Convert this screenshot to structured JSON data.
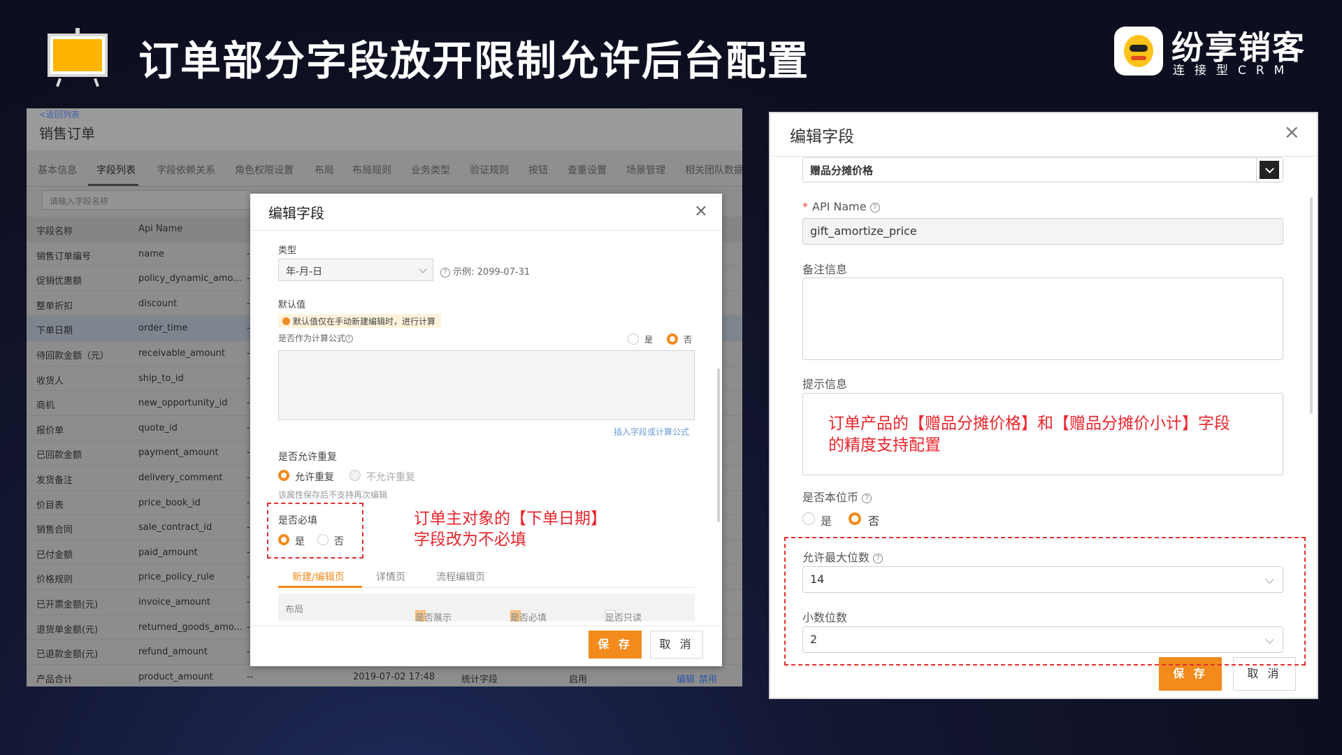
{
  "slide": {
    "title": "订单部分字段放开限制允许后台配置",
    "brand_name": "纷享销客",
    "brand_sub": "连接型CRM",
    "accent": "#f28a1c",
    "note_color": "#e8262d"
  },
  "left_screen": {
    "back_link": "<返回列表",
    "page_title": "销售订单",
    "tabs": [
      "基本信息",
      "字段列表",
      "字段依赖关系",
      "角色权限设置",
      "布局",
      "布局规则",
      "业务类型",
      "验证规则",
      "按钮",
      "查重设置",
      "场景管理",
      "相关团队数据"
    ],
    "active_tab": "字段列表",
    "search_placeholder": "请输入字段名称",
    "table_headers": [
      "字段名称",
      "Api Name"
    ],
    "rows": [
      {
        "name": "销售订单编号",
        "api": "name"
      },
      {
        "name": "促销优惠额",
        "api": "policy_dynamic_amo..."
      },
      {
        "name": "整单折扣",
        "api": "discount"
      },
      {
        "name": "下单日期",
        "api": "order_time"
      },
      {
        "name": "待回款金额（元）",
        "api": "receivable_amount"
      },
      {
        "name": "收货人",
        "api": "ship_to_id"
      },
      {
        "name": "商机",
        "api": "new_opportunity_id"
      },
      {
        "name": "报价单",
        "api": "quote_id"
      },
      {
        "name": "已回款金额",
        "api": "payment_amount"
      },
      {
        "name": "发货备注",
        "api": "delivery_comment"
      },
      {
        "name": "价目表",
        "api": "price_book_id"
      },
      {
        "name": "销售合同",
        "api": "sale_contract_id"
      },
      {
        "name": "已付金额",
        "api": "paid_amount"
      },
      {
        "name": "价格规则",
        "api": "price_policy_rule"
      },
      {
        "name": "已开票金额(元)",
        "api": "invoice_amount"
      },
      {
        "name": "退货单金额(元)",
        "api": "returned_goods_amo..."
      },
      {
        "name": "已退款金额(元)",
        "api": "refund_amount"
      }
    ],
    "last_row": {
      "name": "产品合计",
      "api": "product_amount",
      "dash": "--",
      "time": "2019-07-02 17:48",
      "kind": "统计字段",
      "status": "启用",
      "edit": "编辑",
      "disable": "禁用"
    },
    "row_dash": "--"
  },
  "left_modal": {
    "title": "编辑字段",
    "close": "×",
    "type_label": "类型",
    "type_value": "年-月-日",
    "example": "示例: 2099-07-31",
    "default_label": "默认值",
    "default_warning": "默认值仅在手动新建编辑时，进行计算",
    "formula_label": "是否作为计算公式",
    "yes": "是",
    "no": "否",
    "insert_link": "插入字段或计算公式",
    "dup_label": "是否允许重复",
    "dup_allow": "允许重复",
    "dup_deny": "不允许重复",
    "dup_note": "该属性保存后不支持再次编辑",
    "required_label": "是否必填",
    "note": [
      "订单主对象的【下单日期】",
      "字段改为不必填"
    ],
    "sub_tabs": [
      "新建/编辑页",
      "详情页",
      "流程编辑页"
    ],
    "perm_headers": [
      "布局",
      "是否展示",
      "是否必填",
      "是否只读"
    ],
    "save": "保 存",
    "cancel": "取 消"
  },
  "right_modal": {
    "title": "编辑字段",
    "close": "×",
    "top_field_value": "赠品分摊价格",
    "api_label": "API Name",
    "api_value": "gift_amortize_price",
    "remark_label": "备注信息",
    "hint_label": "提示信息",
    "hint_text": [
      "订单产品的【赠品分摊价格】和【赠品分摊价小计】字段",
      "的精度支持配置"
    ],
    "currency_label": "是否本位币",
    "yes": "是",
    "no": "否",
    "max_digits_label": "允许最大位数",
    "max_digits_value": "14",
    "decimal_label": "小数位数",
    "decimal_value": "2",
    "save": "保 存",
    "cancel": "取 消"
  }
}
